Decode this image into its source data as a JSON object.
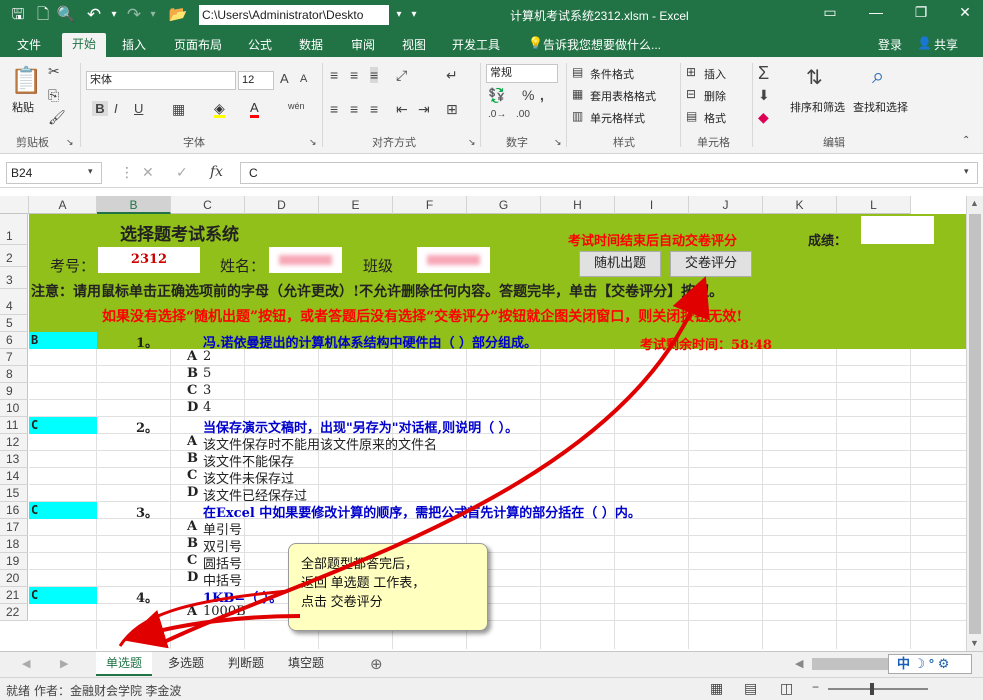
{
  "titlebar": {
    "path": "C:\\Users\\Administrator\\Deskto",
    "window_title": "计算机考试系统2312.xlsm - Excel",
    "icons": [
      "save-icon",
      "new-icon",
      "print-preview-icon",
      "undo-icon",
      "redo-icon",
      "open-icon"
    ]
  },
  "ribbon_tabs": [
    "文件",
    "开始",
    "插入",
    "页面布局",
    "公式",
    "数据",
    "审阅",
    "视图",
    "开发工具"
  ],
  "tell_me": "告诉我您想要做什么...",
  "login": "登录",
  "share": "共享",
  "ribbon": {
    "clipboard": {
      "paste": "粘贴",
      "label": "剪贴板"
    },
    "font": {
      "name": "宋体",
      "size": "12",
      "label": "字体",
      "bold": "B",
      "italic": "I",
      "underline": "U",
      "font_color_letter": "A",
      "wen": "wén"
    },
    "alignment": {
      "label": "对齐方式"
    },
    "number": {
      "format": "常规",
      "label": "数字",
      "percent": "%",
      "comma": ","
    },
    "styles": {
      "conditional": "条件格式",
      "table": "套用表格格式",
      "cell": "单元格样式",
      "label": "样式"
    },
    "cells": {
      "insert": "插入",
      "delete": "删除",
      "format": "格式",
      "label": "单元格"
    },
    "editing": {
      "sort": "排序和筛选",
      "find": "查找和选择",
      "label": "编辑"
    }
  },
  "formula_bar": {
    "name_box": "B24",
    "value": "C",
    "fx": "fx"
  },
  "columns": [
    "A",
    "B",
    "C",
    "D",
    "E",
    "F",
    "G",
    "H",
    "I",
    "J",
    "K",
    "L"
  ],
  "rows": [
    "1",
    "2",
    "3",
    "4",
    "5",
    "6",
    "7",
    "8",
    "9",
    "10",
    "11",
    "12",
    "13",
    "14",
    "15",
    "16",
    "17",
    "18",
    "19",
    "20",
    "21",
    "22"
  ],
  "sheet": {
    "title": "选择题考试系统",
    "auto_submit_note": "考试时间结束后自动交卷评分",
    "score_label": "成绩：",
    "exam_no_label": "考号：",
    "exam_no": "2312",
    "name_label": "姓名：",
    "class_label": "班级",
    "random_button": "随机出题",
    "submit_button": "交卷评分",
    "note1": "注意：请用鼠标单击正确选项前的字母（允许更改）!不允许删除任何内容。答题完毕，单击【交卷评分】按钮。",
    "note2": "如果没有选择“随机出题”按钮，或者答题后没有选择“交卷评分”按钮就企图关闭窗口，则关闭按钮无效!",
    "timer": "考试剩余时间：58:48",
    "questions": [
      {
        "answer": "B",
        "num": "1。",
        "text": "冯.诺依曼提出的计算机体系结构中硬件由（        ）部分组成。",
        "options": [
          {
            "letter": "A",
            "text": "2"
          },
          {
            "letter": "B",
            "text": "5"
          },
          {
            "letter": "C",
            "text": "3"
          },
          {
            "letter": "D",
            "text": "4"
          }
        ]
      },
      {
        "answer": "C",
        "num": "2。",
        "text": "当保存演示文稿时，出现\"另存为\"对话框,则说明（  ）。",
        "options": [
          {
            "letter": "A",
            "text": "该文件保存时不能用该文件原来的文件名"
          },
          {
            "letter": "B",
            "text": "该文件不能保存"
          },
          {
            "letter": "C",
            "text": "该文件未保存过"
          },
          {
            "letter": "D",
            "text": "该文件已经保存过"
          }
        ]
      },
      {
        "answer": "C",
        "num": "3。",
        "text": "在Excel 中如果要修改计算的顺序，需把公式首先计算的部分括在（  ）内。",
        "options": [
          {
            "letter": "A",
            "text": "单引号"
          },
          {
            "letter": "B",
            "text": "双引号"
          },
          {
            "letter": "C",
            "text": "圆括号"
          },
          {
            "letter": "D",
            "text": "中括号"
          }
        ]
      },
      {
        "answer": "C",
        "num": "4。",
        "text": "1KB=（  ）。",
        "options": [
          {
            "letter": "A",
            "text": "1000B"
          }
        ]
      }
    ]
  },
  "callout": {
    "line1": "全部题型都答完后，",
    "line2": "返回 单选题 工作表，",
    "line3": "点击 交卷评分"
  },
  "sheet_tabs": [
    "单选题",
    "多选题",
    "判断题",
    "填空题"
  ],
  "status": {
    "ready": "就绪",
    "author": "作者：金融财会学院 李金波"
  },
  "ime": "中",
  "colors": {
    "excel_green": "#217346",
    "sheet_green": "#92c01a",
    "answer_cyan": "#00ffff",
    "question_blue": "#0000cc",
    "alert_red": "#ff0000",
    "callout_yellow": "#ffffc0"
  }
}
